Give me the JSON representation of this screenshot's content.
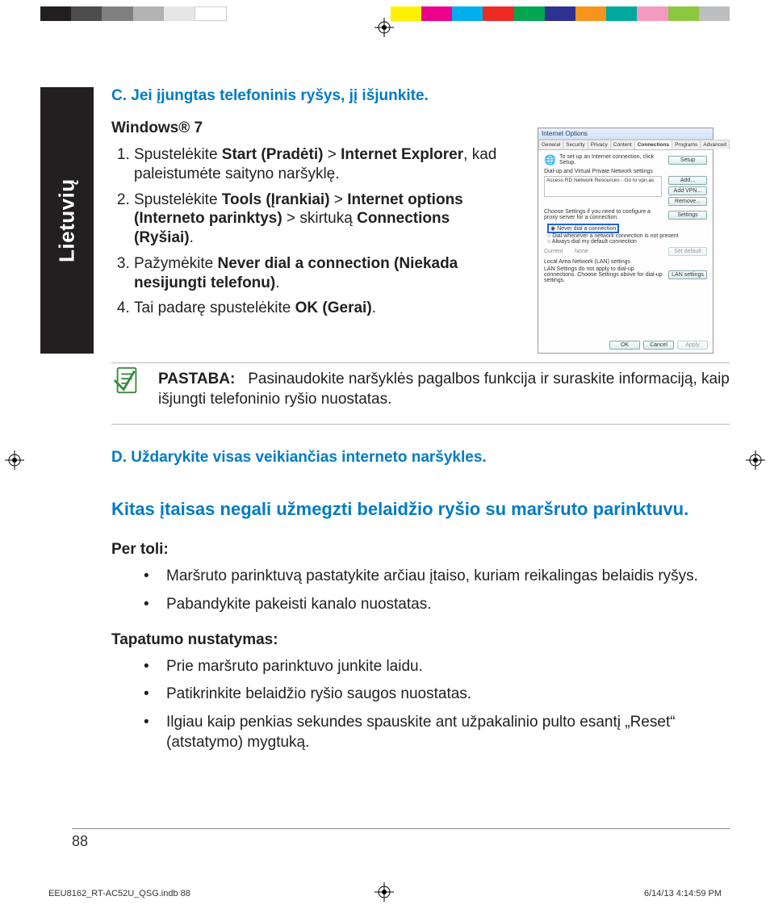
{
  "colorbar_left": [
    "#231f20",
    "#4d4d4d",
    "#808080",
    "#b3b3b3",
    "#e6e6e6",
    "#ffffff"
  ],
  "colorbar_right": [
    "#fff200",
    "#ec008c",
    "#00aeef",
    "#ee2a24",
    "#00a651",
    "#2e3192",
    "#f7941d",
    "#00a99d",
    "#f49ac1",
    "#8dc63f",
    "#bcbec0"
  ],
  "language_tab": "Lietuvių",
  "section_c_heading": "C.  Jei įjungtas telefoninis ryšys, jį išjunkite.",
  "windows_label": "Windows® 7",
  "steps": [
    {
      "pre": "Spustelėkite ",
      "b1": "Start (Pradėti)",
      "mid1": " > ",
      "b2": "Internet Explorer",
      "post": ", kad paleistumėte saityno naršyklę."
    },
    {
      "pre": "Spustelėkite ",
      "b1": "Tools (Įrankiai)",
      "mid1": " > ",
      "b2": "Internet options (Interneto parinktys)",
      "mid2": " > skirtuką ",
      "b3": "Connections (Ryšiai)",
      "post": "."
    },
    {
      "pre": "Pažymėkite ",
      "b1": "Never dial a connection (Niekada nesijungti telefonu)",
      "post": "."
    },
    {
      "pre": "Tai padarę spustelėkite ",
      "b1": "OK (Gerai)",
      "post": "."
    }
  ],
  "dialog": {
    "title": "Internet Options",
    "tabs": [
      "General",
      "Security",
      "Privacy",
      "Content",
      "Connections",
      "Programs",
      "Advanced"
    ],
    "setup_text": "To set up an Internet connection, click Setup.",
    "setup_btn": "Setup",
    "group1": "Dial-up and Virtual Private Network settings",
    "list_item": "Access RD Network Resources - Go to vpn.as",
    "add_btn": "Add...",
    "addvpn_btn": "Add VPN...",
    "remove_btn": "Remove...",
    "proxy_text": "Choose Settings if you need to configure a proxy server for a connection.",
    "settings_btn": "Settings",
    "radio_never": "Never dial a connection",
    "radio_whenever": "Dial whenever a network connection is not present",
    "radio_always": "Always dial my default connection",
    "current_label": "Current",
    "current_val": "None",
    "setdefault_btn": "Set default",
    "group2": "Local Area Network (LAN) settings",
    "lan_text": "LAN Settings do not apply to dial-up connections. Choose Settings above for dial-up settings.",
    "lan_btn": "LAN settings",
    "ok_btn": "OK",
    "cancel_btn": "Cancel",
    "apply_btn": "Apply"
  },
  "note_label": "PASTABA:",
  "note_text": "Pasinaudokite naršyklės pagalbos funkcija ir suraskite informaciją, kaip išjungti telefoninio ryšio nuostatas.",
  "section_d_heading": "D.   Uždarykite visas veikiančias interneto naršykles.",
  "section_e_heading": "Kitas įtaisas negali užmegzti belaidžio ryšio su maršruto parinktuvu.",
  "per_toli_label": "Per toli:",
  "per_toli_items": [
    "Maršruto parinktuvą pastatykite arčiau įtaiso, kuriam reikalingas belaidis ryšys.",
    "Pabandykite pakeisti kanalo nuostatas."
  ],
  "tapatumo_label": "Tapatumo nustatymas:",
  "tapatumo_items": [
    "Prie maršruto parinktuvo junkite laidu.",
    "Patikrinkite belaidžio ryšio saugos nuostatas.",
    "Ilgiau kaip penkias sekundes spauskite ant užpakalinio pulto esantį „Reset“ (atstatymo) mygtuką."
  ],
  "page_number": "88",
  "imposition_left": "EEU8162_RT-AC52U_QSG.indb   88",
  "imposition_right": "6/14/13   4:14:59 PM"
}
